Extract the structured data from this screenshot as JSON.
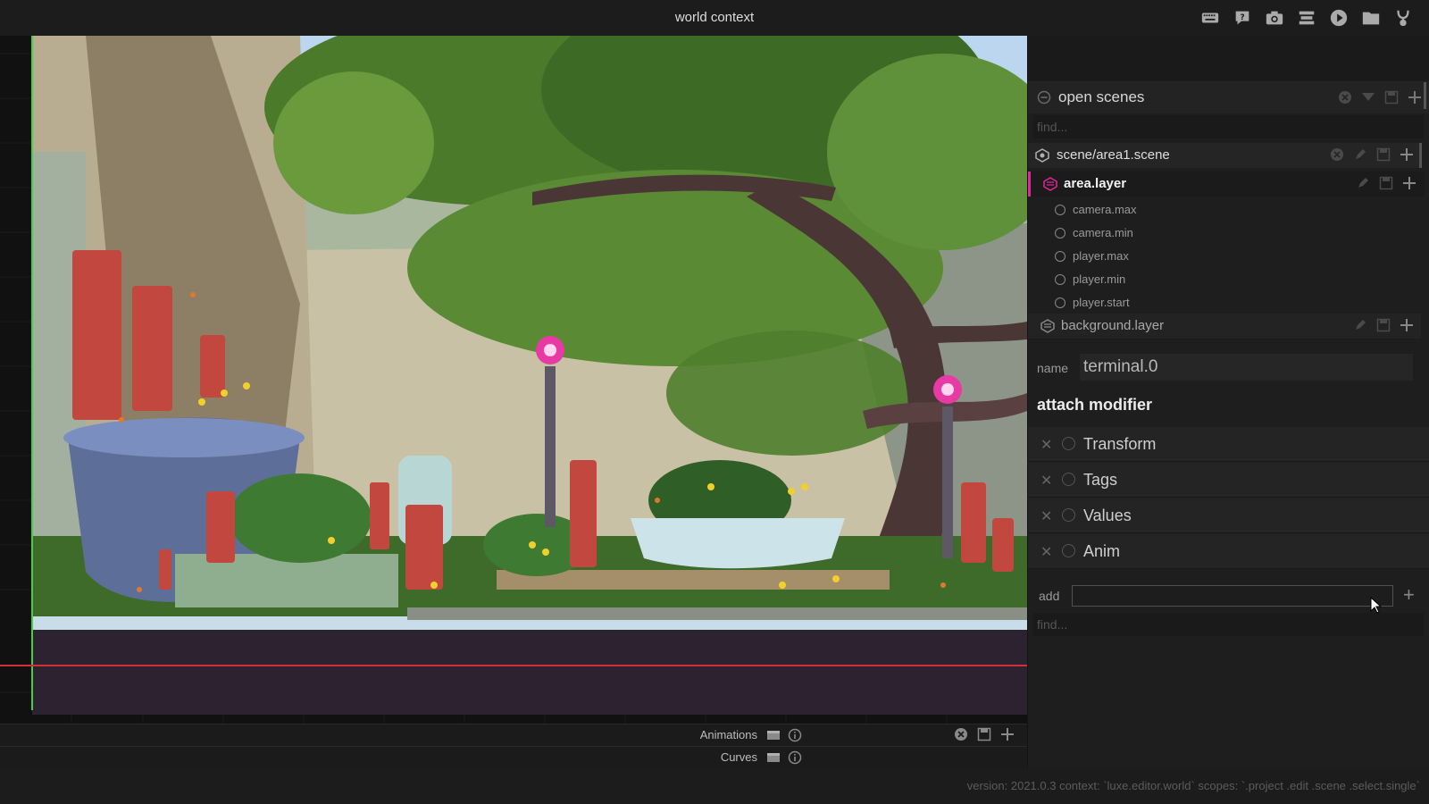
{
  "app": {
    "title": "world context",
    "toolbar": [
      "keyboard-icon",
      "help-icon",
      "camera-icon",
      "build-icon",
      "play-icon",
      "folder-icon",
      "logo-icon"
    ]
  },
  "timeline": {
    "tracks": [
      {
        "label": "Animations"
      },
      {
        "label": "Curves"
      }
    ]
  },
  "panel": {
    "open_scenes": {
      "title": "open scenes",
      "find_placeholder": "find...",
      "scene": {
        "label": "scene/area1.scene"
      },
      "layers": [
        {
          "label": "area.layer",
          "active": true,
          "accent": "#e0289a",
          "entities": [
            "camera.max",
            "camera.min",
            "player.max",
            "player.min",
            "player.start"
          ]
        },
        {
          "label": "background.layer",
          "active": false
        }
      ]
    },
    "name": {
      "label": "name",
      "value": "terminal.0"
    },
    "attach_title": "attach modifier",
    "modifiers": [
      "Transform",
      "Tags",
      "Values",
      "Anim"
    ],
    "add": {
      "label": "add",
      "value": ""
    },
    "find_placeholder": "find..."
  },
  "status": {
    "text": "version: 2021.0.3 context: `luxe.editor.world` scopes: `.project .edit .scene .select.single`"
  },
  "colors": {
    "accent": "#e0289a",
    "timeline_red": "#d0303a",
    "playhead_green": "#44d040"
  }
}
